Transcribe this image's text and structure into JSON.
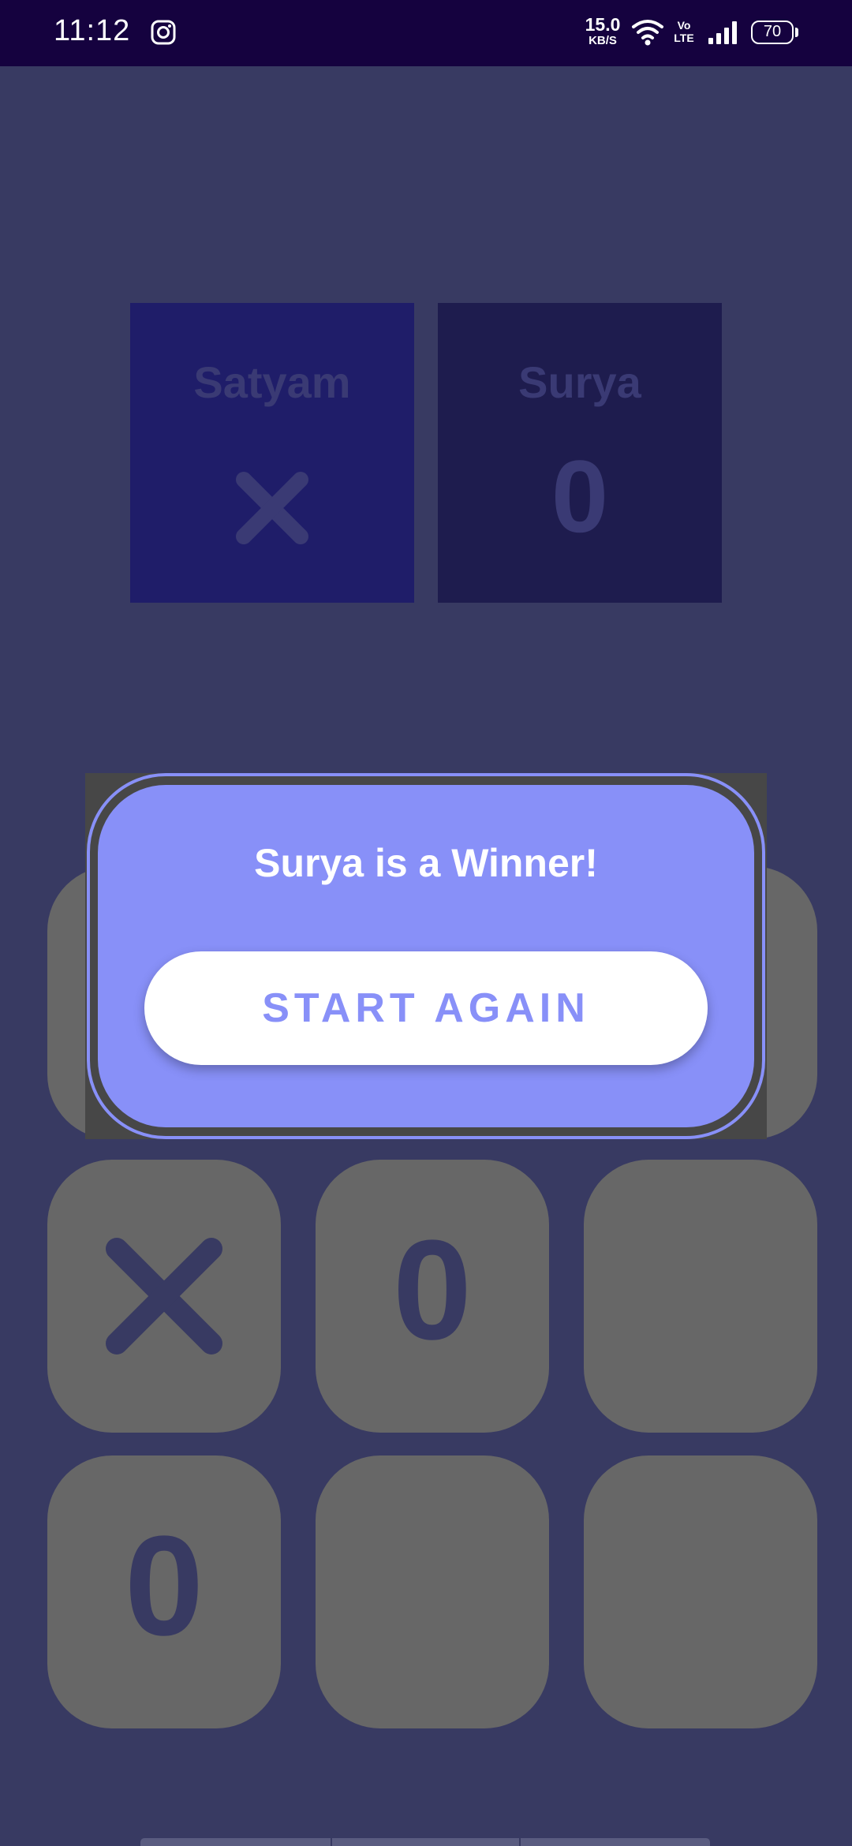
{
  "status_bar": {
    "time": "11:12",
    "net_speed_value": "15.0",
    "net_speed_unit": "KB/S",
    "volte_line1": "Vo",
    "volte_line2": "LTE",
    "battery": "70",
    "icons": [
      "instagram-icon",
      "wifi-icon",
      "volte-icon",
      "signal-icon",
      "battery-icon"
    ]
  },
  "players": [
    {
      "name": "Satyam",
      "symbol": "X"
    },
    {
      "name": "Surya",
      "symbol": "0"
    }
  ],
  "board": {
    "cells": [
      "",
      "",
      "",
      "X",
      "0",
      "",
      "0",
      "",
      ""
    ]
  },
  "dialog": {
    "title": "Surya is a Winner!",
    "button_label": "START AGAIN"
  },
  "colors": {
    "background": "#383a62",
    "status_bar": "#15023f",
    "accent": "#8890f8",
    "cell": "#676767",
    "card_left": "#1f1d69",
    "card_right": "#1e1c4e"
  }
}
